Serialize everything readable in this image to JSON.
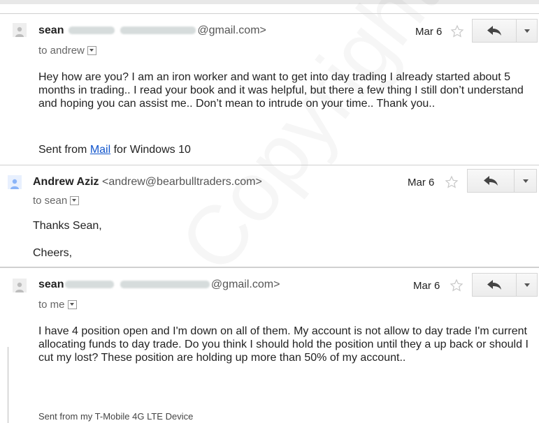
{
  "messages": [
    {
      "sender_name": "sean",
      "sender_email_suffix": "@gmail.com>",
      "recipient": "to andrew",
      "date": "Mar 6",
      "body": "Hey how are you? I  am an iron worker and want to get into day trading I already started about 5 months in trading.. I read your book and it was helpful, but there a few thing I still don’t understand and hoping you can assist me.. Don’t mean to intrude on your time.. Thank you..",
      "signature_prefix": "Sent from ",
      "signature_link": "Mail",
      "signature_suffix": " for Windows 10"
    },
    {
      "sender_name": "Andrew Aziz",
      "sender_email": "<andrew@bearbulltraders.com>",
      "recipient": "to sean",
      "date": "Mar 6",
      "line1": "Thanks Sean,",
      "line2": "Cheers,"
    },
    {
      "sender_name": "sean",
      "sender_email_suffix": "@gmail.com>",
      "recipient": "to me",
      "date": "Mar 6",
      "body": "I have 4 position open and I'm down on all of them. My account is not allow to day trade I'm current allocating funds to day trade. Do you think I should hold the position until they a up back or should I cut my lost? These position are holding up more than 50% of my account..",
      "signature": "Sent from my T-Mobile 4G LTE Device"
    }
  ],
  "watermark": "Copyright - Andrew",
  "icons": {
    "avatar": "person-icon",
    "star": "star-outline-icon",
    "reply": "reply-arrow-icon",
    "more": "chevron-down-icon"
  },
  "colors": {
    "link": "#1155cc",
    "avatar_active": "#8ab4f8",
    "avatar_inactive": "#bdbdbd"
  }
}
